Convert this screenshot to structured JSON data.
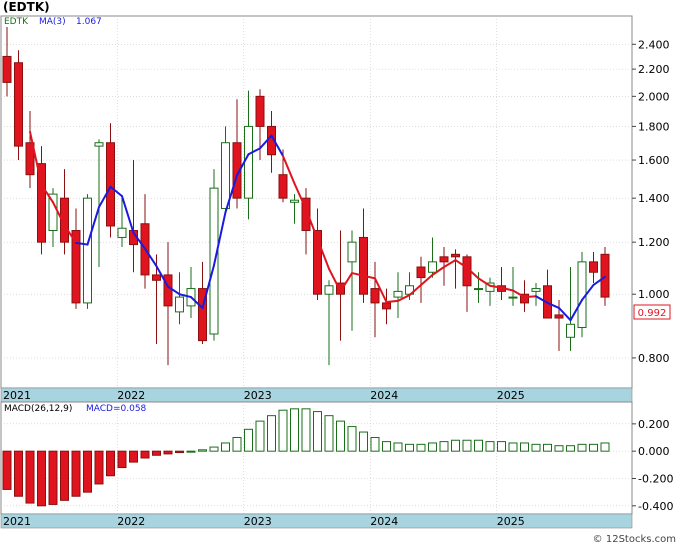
{
  "title": "(EDTK)",
  "legend": {
    "symbol": "EDTK",
    "ma_label": "MA(3)",
    "ma_value": "1.067"
  },
  "macd_legend": {
    "label": "MACD(26,12,9)",
    "value_label": "MACD=0.058"
  },
  "last_price_label": "0.992",
  "watermark": "© 12Stocks.com",
  "colors": {
    "up": "#1a6e1a",
    "down": "#e0141e",
    "ma_red": "#e0141e",
    "ma_blue": "#1a1ae0",
    "macd_neg": "#e0141e",
    "macd_pos": "#1a6e1a",
    "axis_band": "#a8d4e0",
    "grid": "#c8c8c8"
  },
  "chart_data": [
    {
      "type": "candlestick",
      "scale": "log",
      "ylim": [
        0.72,
        2.65
      ],
      "y_ticks": [
        "2.400",
        "2.200",
        "2.000",
        "1.800",
        "1.600",
        "1.400",
        "1.200",
        "1.000",
        "0.800"
      ],
      "y_tick_values": [
        2.4,
        2.2,
        2.0,
        1.8,
        1.6,
        1.4,
        1.2,
        1.0,
        0.8
      ],
      "x_tick_labels": [
        "2021",
        "2022",
        "2023",
        "2024",
        "2025"
      ],
      "x_tick_index": [
        0,
        10,
        21,
        32,
        43
      ],
      "ohlc": [
        [
          2.3,
          2.55,
          2.0,
          2.1
        ],
        [
          2.25,
          2.35,
          1.6,
          1.68
        ],
        [
          1.7,
          1.9,
          1.45,
          1.52
        ],
        [
          1.58,
          1.68,
          1.15,
          1.2
        ],
        [
          1.25,
          1.45,
          1.18,
          1.42
        ],
        [
          1.4,
          1.55,
          1.15,
          1.2
        ],
        [
          1.25,
          1.35,
          0.95,
          0.97
        ],
        [
          0.97,
          1.42,
          0.95,
          1.4
        ],
        [
          1.68,
          1.72,
          1.1,
          1.7
        ],
        [
          1.7,
          1.82,
          1.22,
          1.27
        ],
        [
          1.22,
          1.4,
          1.18,
          1.26
        ],
        [
          1.25,
          1.6,
          1.08,
          1.19
        ],
        [
          1.28,
          1.42,
          1.02,
          1.07
        ],
        [
          1.07,
          1.15,
          0.84,
          1.05
        ],
        [
          1.07,
          1.2,
          0.78,
          0.96
        ],
        [
          0.94,
          1.08,
          0.9,
          0.99
        ],
        [
          0.96,
          1.1,
          0.92,
          1.02
        ],
        [
          1.02,
          1.12,
          0.84,
          0.85
        ],
        [
          0.87,
          1.55,
          0.85,
          1.45
        ],
        [
          1.35,
          1.8,
          1.32,
          1.7
        ],
        [
          1.7,
          1.98,
          1.35,
          1.4
        ],
        [
          1.4,
          2.04,
          1.3,
          1.8
        ],
        [
          2.0,
          2.05,
          1.6,
          1.8
        ],
        [
          1.8,
          1.9,
          1.53,
          1.63
        ],
        [
          1.52,
          1.66,
          1.38,
          1.4
        ],
        [
          1.38,
          1.42,
          1.28,
          1.39
        ],
        [
          1.4,
          1.45,
          1.15,
          1.25
        ],
        [
          1.25,
          1.35,
          0.98,
          1.0
        ],
        [
          1.0,
          1.05,
          0.78,
          1.03
        ],
        [
          1.04,
          1.25,
          0.85,
          1.0
        ],
        [
          1.12,
          1.25,
          0.88,
          1.2
        ],
        [
          1.22,
          1.35,
          0.97,
          1.0
        ],
        [
          1.02,
          1.12,
          0.86,
          0.97
        ],
        [
          0.97,
          1.02,
          0.9,
          0.95
        ],
        [
          0.99,
          1.08,
          0.92,
          1.01
        ],
        [
          1.0,
          1.08,
          0.98,
          1.03
        ],
        [
          1.1,
          1.14,
          0.97,
          1.06
        ],
        [
          1.08,
          1.22,
          1.06,
          1.12
        ],
        [
          1.14,
          1.18,
          1.03,
          1.12
        ],
        [
          1.15,
          1.17,
          1.02,
          1.14
        ],
        [
          1.14,
          1.15,
          0.94,
          1.03
        ],
        [
          1.02,
          1.08,
          0.97,
          1.02
        ],
        [
          1.01,
          1.06,
          0.96,
          1.04
        ],
        [
          1.03,
          1.1,
          0.98,
          1.01
        ],
        [
          0.99,
          1.1,
          0.96,
          0.99
        ],
        [
          1.0,
          1.05,
          0.94,
          0.97
        ],
        [
          1.01,
          1.04,
          0.96,
          1.02
        ],
        [
          1.03,
          1.09,
          0.94,
          0.92
        ],
        [
          0.93,
          0.98,
          0.82,
          0.92
        ],
        [
          0.86,
          1.1,
          0.82,
          0.9
        ],
        [
          0.89,
          1.16,
          0.86,
          1.12
        ],
        [
          1.12,
          1.16,
          1.04,
          1.08
        ],
        [
          1.15,
          1.18,
          0.96,
          0.99
        ]
      ],
      "ma3": [
        null,
        null,
        1.767,
        1.467,
        1.38,
        1.273,
        1.197,
        1.19,
        1.357,
        1.457,
        1.41,
        1.24,
        1.173,
        1.103,
        1.027,
        1.0,
        0.99,
        0.953,
        1.107,
        1.333,
        1.517,
        1.633,
        1.667,
        1.743,
        1.623,
        1.473,
        1.347,
        1.213,
        1.093,
        1.01,
        1.077,
        1.067,
        1.057,
        0.973,
        0.977,
        0.997,
        1.033,
        1.07,
        1.1,
        1.127,
        1.097,
        1.057,
        1.03,
        1.023,
        1.013,
        0.99,
        0.993,
        0.97,
        0.953,
        0.913,
        0.98,
        1.033,
        1.063
      ],
      "ma3_color_switch_index": [
        7,
        25,
        47
      ]
    },
    {
      "type": "bar",
      "title": "MACD(26,12,9)",
      "ylim": [
        -0.46,
        0.36
      ],
      "y_ticks": [
        "0.200",
        "0.000",
        "-0.200",
        "-0.400"
      ],
      "y_tick_values": [
        0.2,
        0.0,
        -0.2,
        -0.4
      ],
      "x_tick_labels": [
        "2021",
        "2022",
        "2023",
        "2024",
        "2025"
      ],
      "values": [
        -0.28,
        -0.33,
        -0.38,
        -0.4,
        -0.39,
        -0.36,
        -0.33,
        -0.3,
        -0.24,
        -0.18,
        -0.12,
        -0.08,
        -0.05,
        -0.03,
        -0.02,
        -0.01,
        0.0,
        0.01,
        0.03,
        0.06,
        0.1,
        0.16,
        0.22,
        0.26,
        0.3,
        0.31,
        0.31,
        0.29,
        0.26,
        0.22,
        0.18,
        0.14,
        0.1,
        0.07,
        0.06,
        0.05,
        0.05,
        0.06,
        0.07,
        0.08,
        0.08,
        0.08,
        0.07,
        0.07,
        0.06,
        0.06,
        0.05,
        0.05,
        0.04,
        0.04,
        0.05,
        0.05,
        0.06
      ]
    }
  ]
}
